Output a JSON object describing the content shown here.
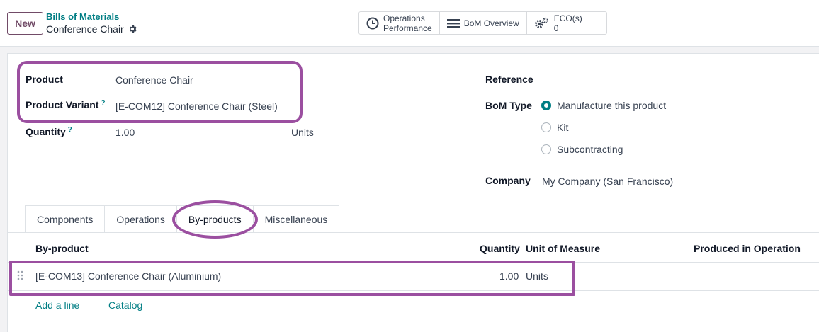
{
  "header": {
    "new_label": "New",
    "breadcrumb_parent": "Bills of Materials",
    "breadcrumb_current": "Conference Chair"
  },
  "smart_buttons": {
    "operations_line1": "Operations",
    "operations_line2": "Performance",
    "bom_overview": "BoM Overview",
    "eco_label": "ECO(s)",
    "eco_count": "0"
  },
  "form": {
    "product_label": "Product",
    "product_value": "Conference Chair",
    "variant_label": "Product Variant",
    "variant_value": "[E-COM12] Conference Chair (Steel)",
    "quantity_label": "Quantity",
    "quantity_value": "1.00",
    "quantity_uom": "Units",
    "help_mark": "?",
    "reference_label": "Reference",
    "bom_type_label": "BoM Type",
    "bom_type_options": [
      "Manufacture this product",
      "Kit",
      "Subcontracting"
    ],
    "bom_type_selected": "Manufacture this product",
    "company_label": "Company",
    "company_value": "My Company (San Francisco)"
  },
  "tabs": [
    "Components",
    "Operations",
    "By-products",
    "Miscellaneous"
  ],
  "active_tab": "By-products",
  "table": {
    "headers": {
      "byproduct": "By-product",
      "quantity": "Quantity",
      "uom": "Unit of Measure",
      "operation": "Produced in Operation"
    },
    "rows": [
      {
        "byproduct": "[E-COM13] Conference Chair (Aluminium)",
        "quantity": "1.00",
        "uom": "Units",
        "operation": ""
      }
    ],
    "add_line": "Add a line",
    "catalog": "Catalog"
  },
  "colors": {
    "brand": "#714b67",
    "accent": "#017e84",
    "highlight": "#9b4fa0"
  }
}
